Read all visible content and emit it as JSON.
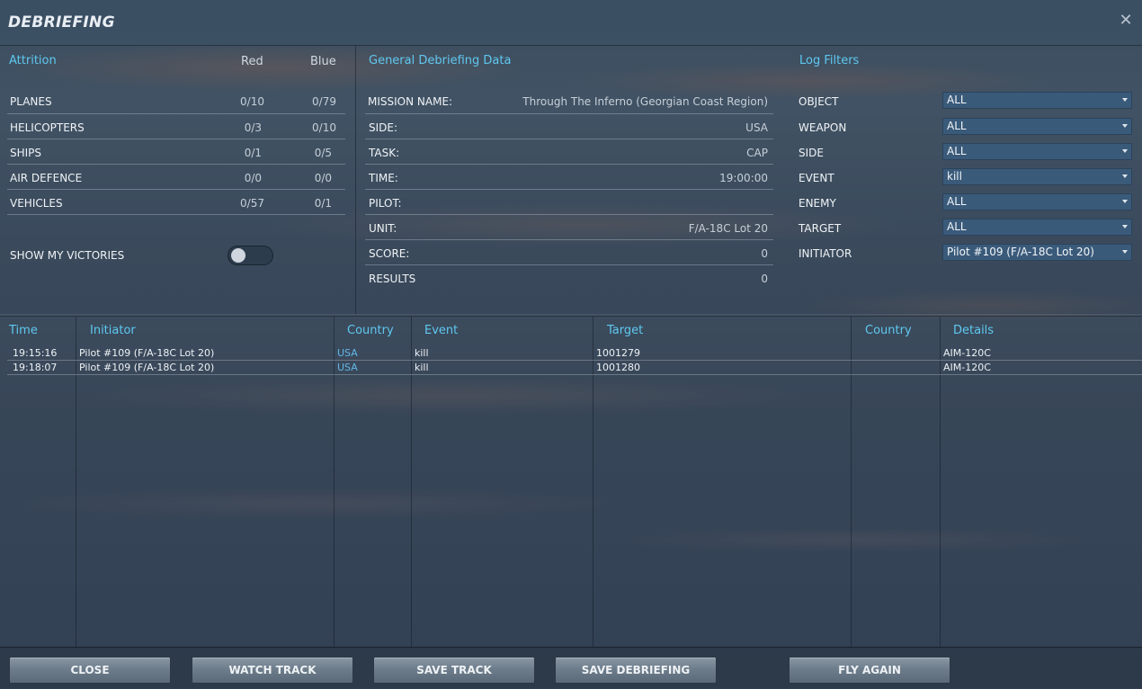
{
  "window": {
    "title": "DEBRIEFING",
    "close_glyph": "✕"
  },
  "attrition": {
    "header": "Attrition",
    "col_red": "Red",
    "col_blue": "Blue",
    "rows": [
      {
        "label": "PLANES",
        "red": "0/10",
        "blue": "0/79"
      },
      {
        "label": "HELICOPTERS",
        "red": "0/3",
        "blue": "0/10"
      },
      {
        "label": "SHIPS",
        "red": "0/1",
        "blue": "0/5"
      },
      {
        "label": "AIR DEFENCE",
        "red": "0/0",
        "blue": "0/0"
      },
      {
        "label": "VEHICLES",
        "red": "0/57",
        "blue": "0/1"
      }
    ],
    "show_victories_label": "SHOW MY VICTORIES",
    "show_victories_on": false
  },
  "general": {
    "header": "General Debriefing Data",
    "rows": [
      {
        "label": "MISSION NAME:",
        "value": "Through The Inferno (Georgian Coast Region)"
      },
      {
        "label": "SIDE:",
        "value": "USA"
      },
      {
        "label": "TASK:",
        "value": "CAP"
      },
      {
        "label": "TIME:",
        "value": "19:00:00"
      },
      {
        "label": "PILOT:",
        "value": ""
      },
      {
        "label": "UNIT:",
        "value": "F/A-18C Lot 20"
      },
      {
        "label": "SCORE:",
        "value": "0"
      },
      {
        "label": "RESULTS",
        "value": "0"
      }
    ]
  },
  "filters": {
    "header": "Log Filters",
    "rows": [
      {
        "label": "OBJECT",
        "value": "ALL"
      },
      {
        "label": "WEAPON",
        "value": "ALL"
      },
      {
        "label": "SIDE",
        "value": "ALL"
      },
      {
        "label": "EVENT",
        "value": "kill"
      },
      {
        "label": "ENEMY",
        "value": "ALL"
      },
      {
        "label": "TARGET",
        "value": "ALL"
      },
      {
        "label": "INITIATOR",
        "value": "Pilot #109 (F/A-18C Lot 20)"
      }
    ]
  },
  "log": {
    "columns": [
      "Time",
      "Initiator",
      "Country",
      "Event",
      "Target",
      "Country",
      "Details"
    ],
    "rows": [
      {
        "time": "19:15:16",
        "initiator": "Pilot #109 (F/A-18C Lot 20)",
        "country": "USA",
        "event": "kill",
        "target": "1001279",
        "target_country": "",
        "details": "AIM-120C"
      },
      {
        "time": "19:18:07",
        "initiator": "Pilot #109 (F/A-18C Lot 20)",
        "country": "USA",
        "event": "kill",
        "target": "1001280",
        "target_country": "",
        "details": "AIM-120C"
      }
    ]
  },
  "buttons": {
    "close": "CLOSE",
    "watch_track": "WATCH TRACK",
    "save_track": "SAVE TRACK",
    "save_debriefing": "SAVE DEBRIEFING",
    "fly_again": "FLY AGAIN"
  },
  "colors": {
    "accent_header": "#5fc8f0",
    "link": "#62b8e8",
    "select_bg": "#3a5a7a"
  }
}
